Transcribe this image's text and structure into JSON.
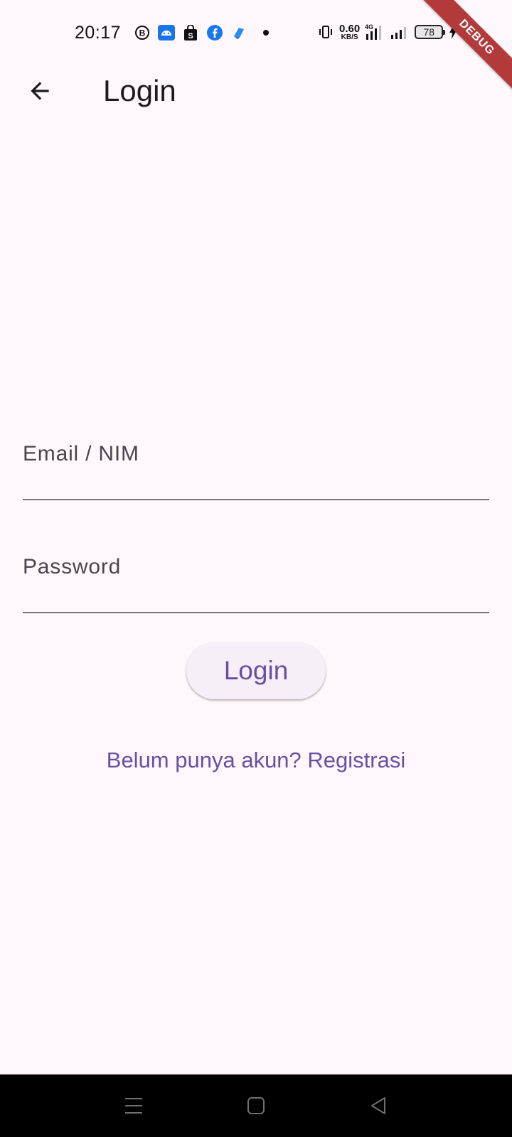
{
  "status_bar": {
    "time": "20:17",
    "notification_icons": [
      "b-circle-icon",
      "android-icon",
      "shopping-bag-s-icon",
      "facebook-icon",
      "blue-app-icon",
      "dot-icon"
    ],
    "net_speed_value": "0.60",
    "net_speed_unit": "KB/S",
    "network_type": "4G",
    "battery_level": "78"
  },
  "debug_banner": "DEBUG",
  "app_bar": {
    "title": "Login"
  },
  "form": {
    "email_label": "Email / NIM",
    "email_value": "",
    "password_label": "Password",
    "password_value": "",
    "login_button": "Login",
    "register_link": "Belum punya akun? Registrasi"
  },
  "colors": {
    "background": "#fef7fc",
    "primary": "#6650a4",
    "button_surface": "#f6eff7",
    "debug_ribbon": "#b33a3a",
    "nav_bar": "#000000"
  }
}
